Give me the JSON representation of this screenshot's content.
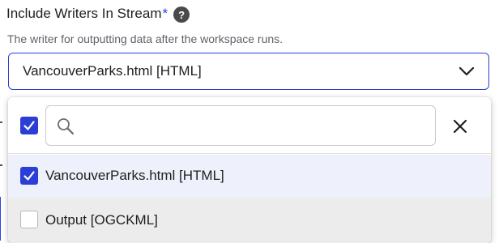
{
  "field": {
    "label": "Include Writers In Stream",
    "required_mark": "*",
    "help_icon_glyph": "?",
    "help_icon": "question-circle-icon",
    "description": "The writer for outputting data after the workspace runs."
  },
  "select": {
    "value": "VancouverParks.html [HTML]",
    "chevron_icon": "chevron-down-icon",
    "border_color": "#2b3fd6"
  },
  "dropdown": {
    "select_all_checked": true,
    "search": {
      "value": "",
      "placeholder": "",
      "icon": "search-icon"
    },
    "clear_icon": "close-icon",
    "options": [
      {
        "label": "VancouverParks.html [HTML]",
        "checked": true
      },
      {
        "label": "Output [OGCKML]",
        "checked": false
      }
    ]
  },
  "colors": {
    "accent": "#2b3fd6",
    "selected_row_bg": "#eef0fb",
    "hover_row_bg": "#ececec"
  }
}
